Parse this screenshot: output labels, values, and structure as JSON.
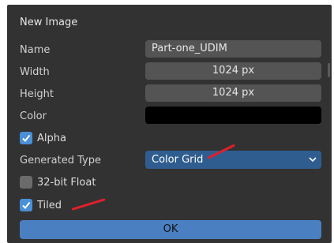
{
  "dialog": {
    "title": "New Image",
    "fields": {
      "name_label": "Name",
      "name_value": "Part-one_UDIM",
      "width_label": "Width",
      "width_value": "1024 px",
      "height_label": "Height",
      "height_value": "1024 px",
      "color_label": "Color",
      "color_value": "#000000"
    },
    "alpha": {
      "label": "Alpha",
      "checked": true
    },
    "generated_type": {
      "label": "Generated Type",
      "value": "Color Grid"
    },
    "float32": {
      "label": "32-bit Float",
      "checked": false
    },
    "tiled": {
      "label": "Tiled",
      "checked": true
    },
    "ok_label": "OK"
  },
  "colors": {
    "panel": "#323232",
    "field": "#545454",
    "accent": "#4a90d8",
    "select": "#2f5d8f",
    "ok": "#4a7fc2",
    "annotation": "#e0202a"
  }
}
